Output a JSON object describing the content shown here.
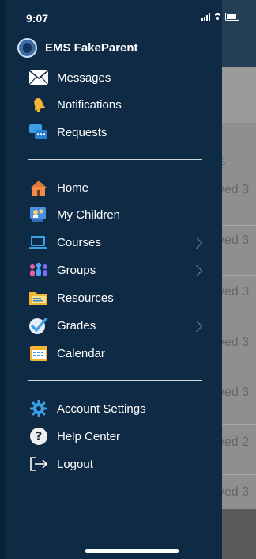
{
  "status_bar": {
    "time": "9:07"
  },
  "profile": {
    "name": "EMS FakeParent"
  },
  "menu_top": [
    {
      "label": "Messages",
      "icon": "envelope-icon"
    },
    {
      "label": "Notifications",
      "icon": "bell-icon"
    },
    {
      "label": "Requests",
      "icon": "chat-icon"
    }
  ],
  "menu_main": [
    {
      "label": "Home",
      "icon": "home-icon"
    },
    {
      "label": "My Children",
      "icon": "children-icon"
    },
    {
      "label": "Courses",
      "icon": "courses-icon"
    },
    {
      "label": "Groups",
      "icon": "groups-icon"
    },
    {
      "label": "Resources",
      "icon": "folder-icon"
    },
    {
      "label": "Grades",
      "icon": "grades-icon"
    },
    {
      "label": "Calendar",
      "icon": "calendar-icon"
    }
  ],
  "menu_bottom": [
    {
      "label": "Account Settings",
      "icon": "settings-icon"
    },
    {
      "label": "Help Center",
      "icon": "help-icon"
    },
    {
      "label": "Logout",
      "icon": "logout-icon"
    }
  ],
  "background": {
    "tab_fragment": "s",
    "rows": [
      "ved 3",
      "ved 3",
      "ved 3",
      "ved 3",
      "ved 3",
      "ved 2",
      "ved 3"
    ]
  }
}
